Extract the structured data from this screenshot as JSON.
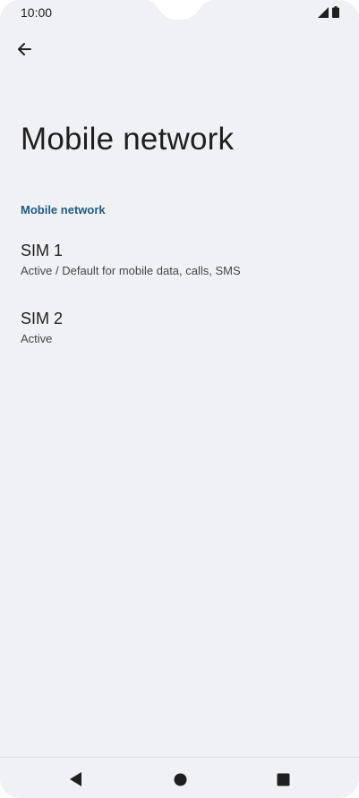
{
  "status_bar": {
    "time": "10:00",
    "icons": [
      "signal-icon",
      "battery-icon"
    ]
  },
  "app_bar": {
    "back_icon": "arrow-back-icon"
  },
  "page": {
    "title": "Mobile network",
    "section_header": "Mobile network"
  },
  "sims": [
    {
      "title": "SIM 1",
      "summary": "Active / Default for mobile data, calls, SMS"
    },
    {
      "title": "SIM 2",
      "summary": "Active"
    }
  ],
  "nav_bar": {
    "icons": [
      "nav-back-icon",
      "nav-home-icon",
      "nav-recents-icon"
    ]
  },
  "colors": {
    "background": "#f0f1f4",
    "accent": "#225b82",
    "text_primary": "#1f1f1f",
    "text_secondary": "#444746"
  }
}
